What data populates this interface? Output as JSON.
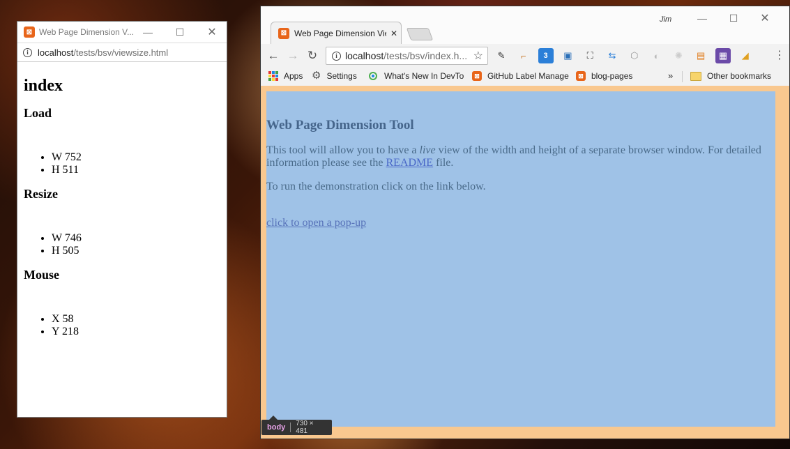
{
  "popup_window": {
    "title": "Web Page Dimension V...",
    "url_host": "localhost",
    "url_path": "/tests/bsv/viewsize.html",
    "content": {
      "heading": "index",
      "sections": [
        {
          "title": "Load",
          "items": [
            "W 752",
            "H 511"
          ]
        },
        {
          "title": "Resize",
          "items": [
            "W 746",
            "H 505"
          ]
        },
        {
          "title": "Mouse",
          "items": [
            "X 58",
            "Y 218"
          ]
        }
      ]
    }
  },
  "browser_window": {
    "profile": "Jim",
    "tab_title": "Web Page Dimension Vie",
    "url_host": "localhost",
    "url_path": "/tests/bsv/index.h...",
    "bookmarks": {
      "apps": "Apps",
      "settings": "Settings",
      "devtools": "What's New In DevTo",
      "github": "GitHub Label Manage",
      "blog": "blog-pages",
      "overflow": "»",
      "other": "Other bookmarks"
    },
    "page": {
      "title": "Web Page Dimension Tool",
      "intro_before": "This tool will allow you to have a ",
      "intro_italic": "live",
      "intro_after": " view of the width and height of a separate browser window. For detailed information please see the ",
      "readme_link": "README",
      "intro_end": " file.",
      "instruction": "To run the demonstration click on the link below.",
      "popup_link": "click to open a pop-up"
    },
    "inspect_tooltip": {
      "tag": "body",
      "dims": "730 × 481"
    }
  },
  "colors": {
    "page_background": "#9fc2e7",
    "body_margin": "#f9c88f",
    "favicon": "#e8651a",
    "link": "#4a68c8"
  }
}
